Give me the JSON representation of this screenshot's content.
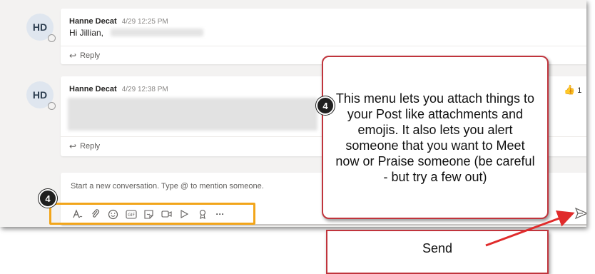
{
  "posts": [
    {
      "avatar": "HD",
      "author": "Hanne Decat",
      "time": "4/29 12:25 PM",
      "text": "Hi Jillian,",
      "reply_label": "Reply"
    },
    {
      "avatar": "HD",
      "author": "Hanne Decat",
      "time": "4/29 12:38 PM",
      "reply_label": "Reply",
      "reaction": {
        "icon": "thumbs-up-icon",
        "count": "1"
      }
    }
  ],
  "compose": {
    "placeholder": "Start a new conversation. Type @ to mention someone.",
    "toolbar": [
      {
        "name": "format-icon",
        "glyph": "A"
      },
      {
        "name": "attach-icon",
        "glyph": "⌀"
      },
      {
        "name": "emoji-icon",
        "glyph": "☺"
      },
      {
        "name": "gif-icon",
        "glyph": "GIF"
      },
      {
        "name": "sticker-icon",
        "glyph": "▢"
      },
      {
        "name": "meet-now-icon",
        "glyph": "▭"
      },
      {
        "name": "stream-icon",
        "glyph": "▷"
      },
      {
        "name": "praise-icon",
        "glyph": "♀"
      },
      {
        "name": "more-options-icon",
        "glyph": "···"
      }
    ],
    "send_icon": "send-icon"
  },
  "annotations": {
    "step_number": "4",
    "menu_callout": "This menu lets you attach things to your Post like attachments and emojis. It also lets you alert someone that you want to Meet now or Praise someone (be careful - but try a few out)",
    "send_callout": "Send",
    "highlight_color": "#f2a51a",
    "callout_border_color": "#c0343c",
    "arrow_color": "#e02b2b"
  }
}
